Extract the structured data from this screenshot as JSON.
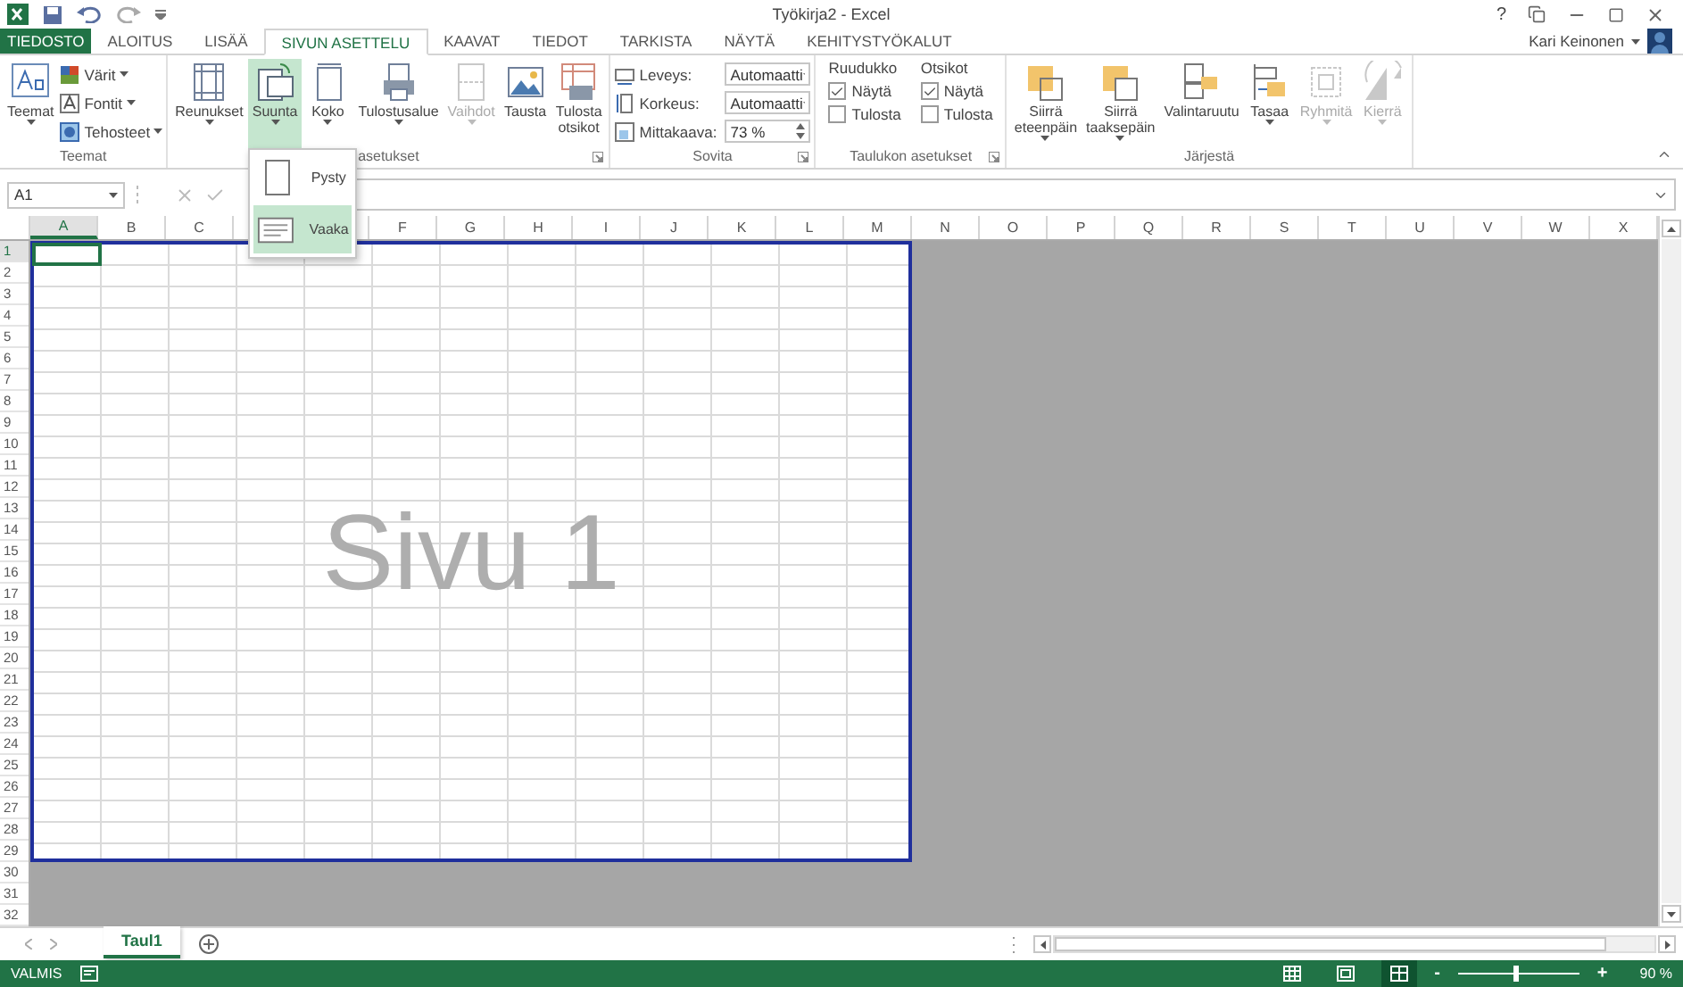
{
  "window": {
    "title": "Työkirja2 - Excel",
    "help": "?",
    "user": "Kari Keinonen"
  },
  "tabs": [
    {
      "label": "TIEDOSTO",
      "kind": "file",
      "selected": false
    },
    {
      "label": "ALOITUS",
      "kind": "tab",
      "selected": false
    },
    {
      "label": "LISÄÄ",
      "kind": "tab",
      "selected": false
    },
    {
      "label": "SIVUN ASETTELU",
      "kind": "tab",
      "selected": true
    },
    {
      "label": "KAAVAT",
      "kind": "tab",
      "selected": false
    },
    {
      "label": "TIEDOT",
      "kind": "tab",
      "selected": false
    },
    {
      "label": "TARKISTA",
      "kind": "tab",
      "selected": false
    },
    {
      "label": "NÄYTÄ",
      "kind": "tab",
      "selected": false
    },
    {
      "label": "KEHITYSTYÖKALUT",
      "kind": "tab",
      "selected": false
    }
  ],
  "ribbon": {
    "groups": [
      {
        "label": "Teemat",
        "launcher": false,
        "items": [
          {
            "kind": "large",
            "lines": [
              "Teemat"
            ],
            "menu": true,
            "disabled": false,
            "selected": false
          },
          {
            "kind": "small",
            "label": "Värit",
            "menu": true
          },
          {
            "kind": "small",
            "label": "Fontit",
            "menu": true
          },
          {
            "kind": "small",
            "label": "Tehosteet",
            "menu": true
          }
        ]
      },
      {
        "label": "asetukset",
        "launcher": true,
        "items": [
          {
            "kind": "large",
            "lines": [
              "Reunukset"
            ],
            "menu": true,
            "disabled": false,
            "selected": false
          },
          {
            "kind": "large",
            "lines": [
              "Suunta"
            ],
            "menu": true,
            "disabled": false,
            "selected": true
          },
          {
            "kind": "large",
            "lines": [
              "Koko"
            ],
            "menu": true,
            "disabled": false,
            "selected": false
          },
          {
            "kind": "large",
            "lines": [
              "Tulostusalue"
            ],
            "menu": true,
            "disabled": false,
            "selected": false
          },
          {
            "kind": "large",
            "lines": [
              "Vaihdot"
            ],
            "menu": true,
            "disabled": true,
            "selected": false
          },
          {
            "kind": "large",
            "lines": [
              "Tausta"
            ],
            "menu": false,
            "disabled": false,
            "selected": false
          },
          {
            "kind": "large",
            "lines": [
              "Tulosta",
              "otsikot"
            ],
            "menu": false,
            "disabled": false,
            "selected": false
          }
        ]
      },
      {
        "label": "Sovita",
        "launcher": true,
        "items": [
          {
            "kind": "dropdown",
            "label": "Leveys:",
            "value": "Automaatti"
          },
          {
            "kind": "dropdown",
            "label": "Korkeus:",
            "value": "Automaatti"
          },
          {
            "kind": "spinner",
            "label": "Mittakaava:",
            "value": "73 %"
          }
        ]
      },
      {
        "label": "Taulukon asetukset",
        "launcher": true,
        "items": [
          {
            "kind": "checks",
            "heading": "Ruudukko",
            "options": [
              {
                "label": "Näytä",
                "checked": true
              },
              {
                "label": "Tulosta",
                "checked": false
              }
            ]
          },
          {
            "kind": "checks",
            "heading": "Otsikot",
            "options": [
              {
                "label": "Näytä",
                "checked": true
              },
              {
                "label": "Tulosta",
                "checked": false
              }
            ]
          }
        ]
      },
      {
        "label": "Järjestä",
        "launcher": false,
        "items": [
          {
            "kind": "large",
            "lines": [
              "Siirrä",
              "eteenpäin"
            ],
            "menu": true,
            "disabled": false,
            "selected": false
          },
          {
            "kind": "large",
            "lines": [
              "Siirrä",
              "taaksepäin"
            ],
            "menu": true,
            "disabled": false,
            "selected": false
          },
          {
            "kind": "large",
            "lines": [
              "Valintaruutu"
            ],
            "menu": false,
            "disabled": false,
            "selected": false
          },
          {
            "kind": "large",
            "lines": [
              "Tasaa"
            ],
            "menu": true,
            "disabled": false,
            "selected": false
          },
          {
            "kind": "large",
            "lines": [
              "Ryhmitä"
            ],
            "menu": true,
            "disabled": true,
            "selected": false
          },
          {
            "kind": "large",
            "lines": [
              "Kierrä"
            ],
            "menu": true,
            "disabled": true,
            "selected": false
          }
        ]
      }
    ]
  },
  "orientation_menu": [
    {
      "label": "Pysty",
      "selected": false
    },
    {
      "label": "Vaaka",
      "selected": true
    }
  ],
  "formula_bar": {
    "name_box": "A1"
  },
  "sheet": {
    "columns": [
      {
        "label": "A",
        "selected": true
      },
      {
        "label": "B",
        "selected": false
      },
      {
        "label": "C",
        "selected": false
      },
      {
        "selected": false
      },
      {
        "selected": false
      },
      {
        "label": "F",
        "selected": false
      },
      {
        "label": "G",
        "selected": false
      },
      {
        "label": "H",
        "selected": false
      },
      {
        "label": "I",
        "selected": false
      },
      {
        "label": "J",
        "selected": false
      },
      {
        "label": "K",
        "selected": false
      },
      {
        "label": "L",
        "selected": false
      },
      {
        "label": "M",
        "selected": false
      },
      {
        "label": "N",
        "selected": false
      },
      {
        "label": "O",
        "selected": false
      },
      {
        "label": "P",
        "selected": false
      },
      {
        "label": "Q",
        "selected": false
      },
      {
        "label": "R",
        "selected": false
      },
      {
        "label": "S",
        "selected": false
      },
      {
        "label": "T",
        "selected": false
      },
      {
        "label": "U",
        "selected": false
      },
      {
        "label": "V",
        "selected": false
      },
      {
        "label": "W",
        "selected": false
      },
      {
        "label": "X",
        "selected": false
      }
    ],
    "rows": [
      {
        "label": "1",
        "selected": true
      },
      {
        "label": "2",
        "selected": false
      },
      {
        "label": "3",
        "selected": false
      },
      {
        "label": "4",
        "selected": false
      },
      {
        "label": "5",
        "selected": false
      },
      {
        "label": "6",
        "selected": false
      },
      {
        "label": "7",
        "selected": false
      },
      {
        "label": "8",
        "selected": false
      },
      {
        "label": "9",
        "selected": false
      },
      {
        "label": "10",
        "selected": false
      },
      {
        "label": "11",
        "selected": false
      },
      {
        "label": "12",
        "selected": false
      },
      {
        "label": "13",
        "selected": false
      },
      {
        "label": "14",
        "selected": false
      },
      {
        "label": "15",
        "selected": false
      },
      {
        "label": "16",
        "selected": false
      },
      {
        "label": "17",
        "selected": false
      },
      {
        "label": "18",
        "selected": false
      },
      {
        "label": "19",
        "selected": false
      },
      {
        "label": "20",
        "selected": false
      },
      {
        "label": "21",
        "selected": false
      },
      {
        "label": "22",
        "selected": false
      },
      {
        "label": "23",
        "selected": false
      },
      {
        "label": "24",
        "selected": false
      },
      {
        "label": "25",
        "selected": false
      },
      {
        "label": "26",
        "selected": false
      },
      {
        "label": "27",
        "selected": false
      },
      {
        "label": "28",
        "selected": false
      },
      {
        "label": "29",
        "selected": false
      },
      {
        "label": "30",
        "selected": false
      },
      {
        "label": "31",
        "selected": false
      },
      {
        "label": "32",
        "selected": false
      }
    ],
    "page_label": "Sivu 1"
  },
  "sheet_tabs": [
    {
      "label": "Taul1",
      "selected": true
    }
  ],
  "status_bar": {
    "status": "VALMIS",
    "views": [
      {
        "selected": false
      },
      {
        "selected": false
      },
      {
        "selected": true
      }
    ],
    "zoom": {
      "minus": "-",
      "plus": "+",
      "level": 0.47,
      "reading": "90 %"
    }
  }
}
